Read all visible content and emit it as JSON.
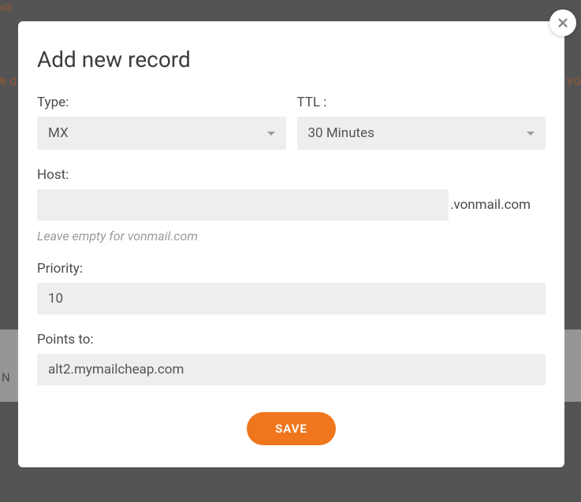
{
  "background": {
    "topLeft": "oS",
    "leftTab": "R O",
    "rightTab": "VO",
    "n": "N"
  },
  "modal": {
    "title": "Add new record",
    "fields": {
      "type": {
        "label": "Type:",
        "value": "MX"
      },
      "ttl": {
        "label": "TTL :",
        "value": "30 Minutes"
      },
      "host": {
        "label": "Host:",
        "value": "",
        "suffix": ".vonmail.com",
        "hint": "Leave empty for vonmail.com"
      },
      "priority": {
        "label": "Priority:",
        "value": "10"
      },
      "pointsTo": {
        "label": "Points to:",
        "value": "alt2.mymailcheap.com"
      }
    },
    "saveLabel": "SAVE"
  }
}
